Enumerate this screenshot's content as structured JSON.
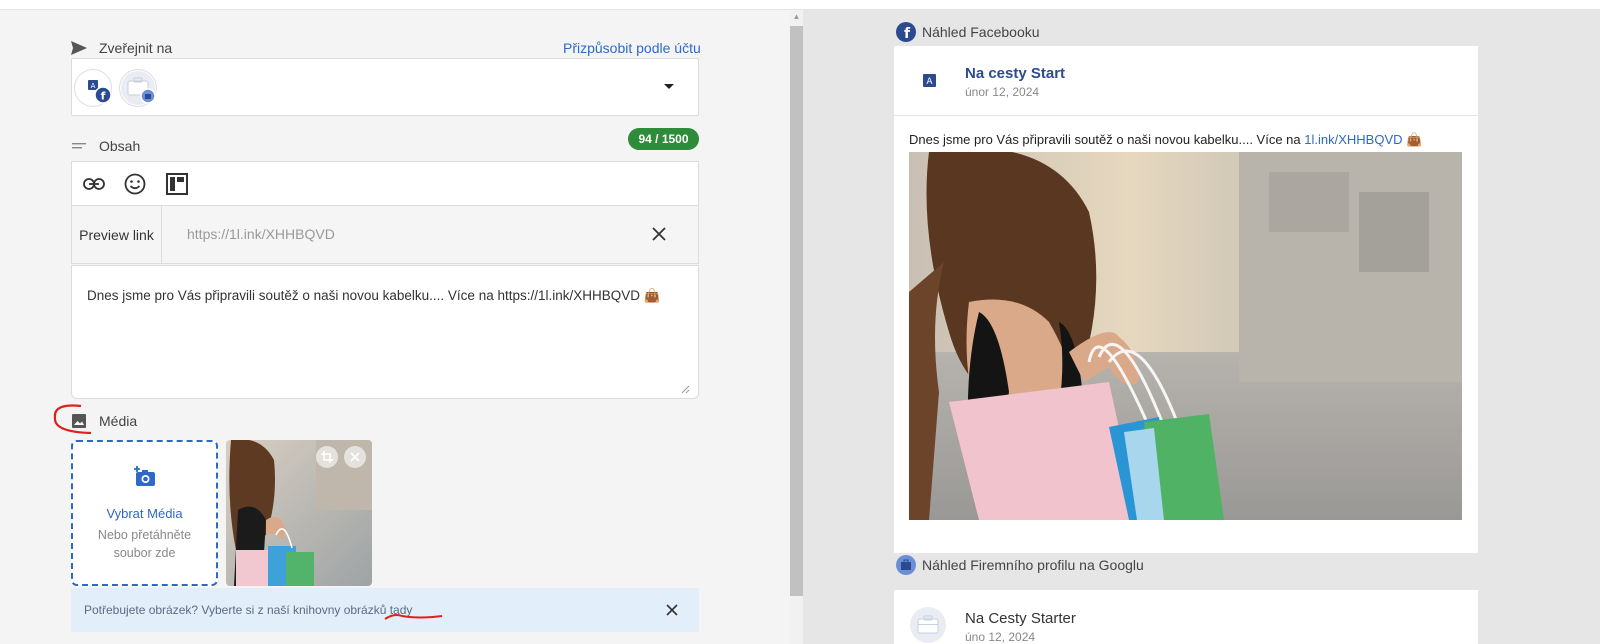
{
  "publish": {
    "label": "Zveřejnit na",
    "customize_link": "Přizpůsobit podle účtu"
  },
  "content": {
    "label": "Obsah",
    "counter": "94 / 1500"
  },
  "preview_link": {
    "label": "Preview link",
    "url": "https://1l.ink/XHHBQVD"
  },
  "editor": {
    "text": "Dnes jsme pro Vás připravili soutěž o naši novou kabelku.... Více na https://1l.ink/XHHBQVD 👜"
  },
  "media": {
    "label": "Média",
    "select_label": "Vybrat Média",
    "drop_hint": "Nebo přetáhněte soubor zde"
  },
  "banner": {
    "text": "Potřebujete obrázek? Vyberte si z naší knihovny obrázků tady"
  },
  "facebook_preview": {
    "label": "Náhled Facebooku",
    "page_name": "Na cesty Start",
    "date": "únor 12, 2024",
    "text_before": "Dnes jsme pro Vás připravili soutěž o naši novou kabelku.... Více na ",
    "link": "1l.ink/XHHBQVD",
    "emoji": "👜"
  },
  "google_preview": {
    "label": "Náhled Firemního profilu na Googlu",
    "page_name": "Na Cesty Starter",
    "date": "úno 12, 2024"
  },
  "colors": {
    "accent_blue": "#2f69c8",
    "counter_green": "#2e8b3a",
    "facebook_blue": "#1877f2",
    "annotation_red": "#e0201c"
  }
}
